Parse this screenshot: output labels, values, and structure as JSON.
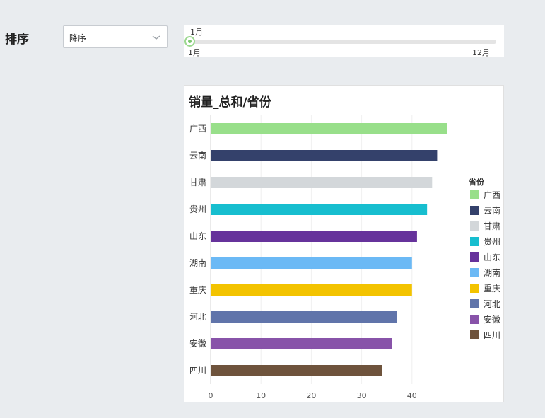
{
  "sort": {
    "label": "排序",
    "selected": "降序"
  },
  "month_slider": {
    "current": "1月",
    "min_label": "1月",
    "max_label": "12月",
    "position": 0.0
  },
  "chart_data": {
    "type": "bar",
    "orientation": "horizontal",
    "title": "销量_总和/省份",
    "xlabel": "",
    "ylabel": "",
    "xlim": [
      0,
      50
    ],
    "x_ticks": [
      0,
      10,
      20,
      30,
      40
    ],
    "grid": true,
    "legend_title": "省份",
    "legend_position": "right",
    "categories": [
      "广西",
      "云南",
      "甘肃",
      "贵州",
      "山东",
      "湖南",
      "重庆",
      "河北",
      "安徽",
      "四川"
    ],
    "values": [
      47,
      45,
      44,
      43,
      41,
      40,
      40,
      37,
      36,
      34
    ],
    "colors": [
      "#98df8a",
      "#34416b",
      "#d3d7da",
      "#17becf",
      "#66329b",
      "#6bb9f5",
      "#f3c300",
      "#6074aa",
      "#8853a9",
      "#6e533c"
    ]
  }
}
